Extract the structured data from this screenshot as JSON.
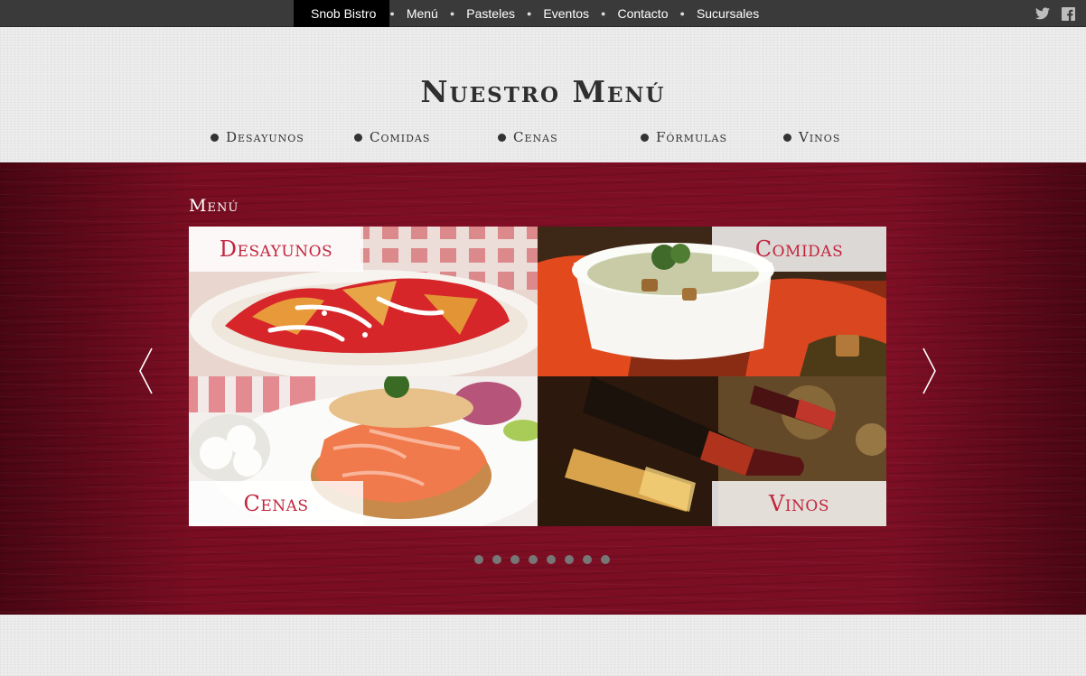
{
  "topnav": {
    "items": [
      "Snob Bistro",
      "Menú",
      "Pasteles",
      "Eventos",
      "Contacto",
      "Sucursales"
    ]
  },
  "social": {
    "icons": [
      "twitter-icon",
      "facebook-icon"
    ]
  },
  "header": {
    "title": "Nuestro Menú",
    "subnav": [
      "Desayunos",
      "Comidas",
      "Cenas",
      "Fórmulas",
      "Vinos"
    ]
  },
  "menu_section": {
    "label": "Menú",
    "tiles": [
      "Desayunos",
      "Comidas",
      "Cenas",
      "Vinos"
    ]
  },
  "carousel": {
    "page_count": 8,
    "active_index": 0
  },
  "colors": {
    "topbar": "#3a3a3a",
    "accent": "#c2253e",
    "wood": "#6d0b1e"
  }
}
